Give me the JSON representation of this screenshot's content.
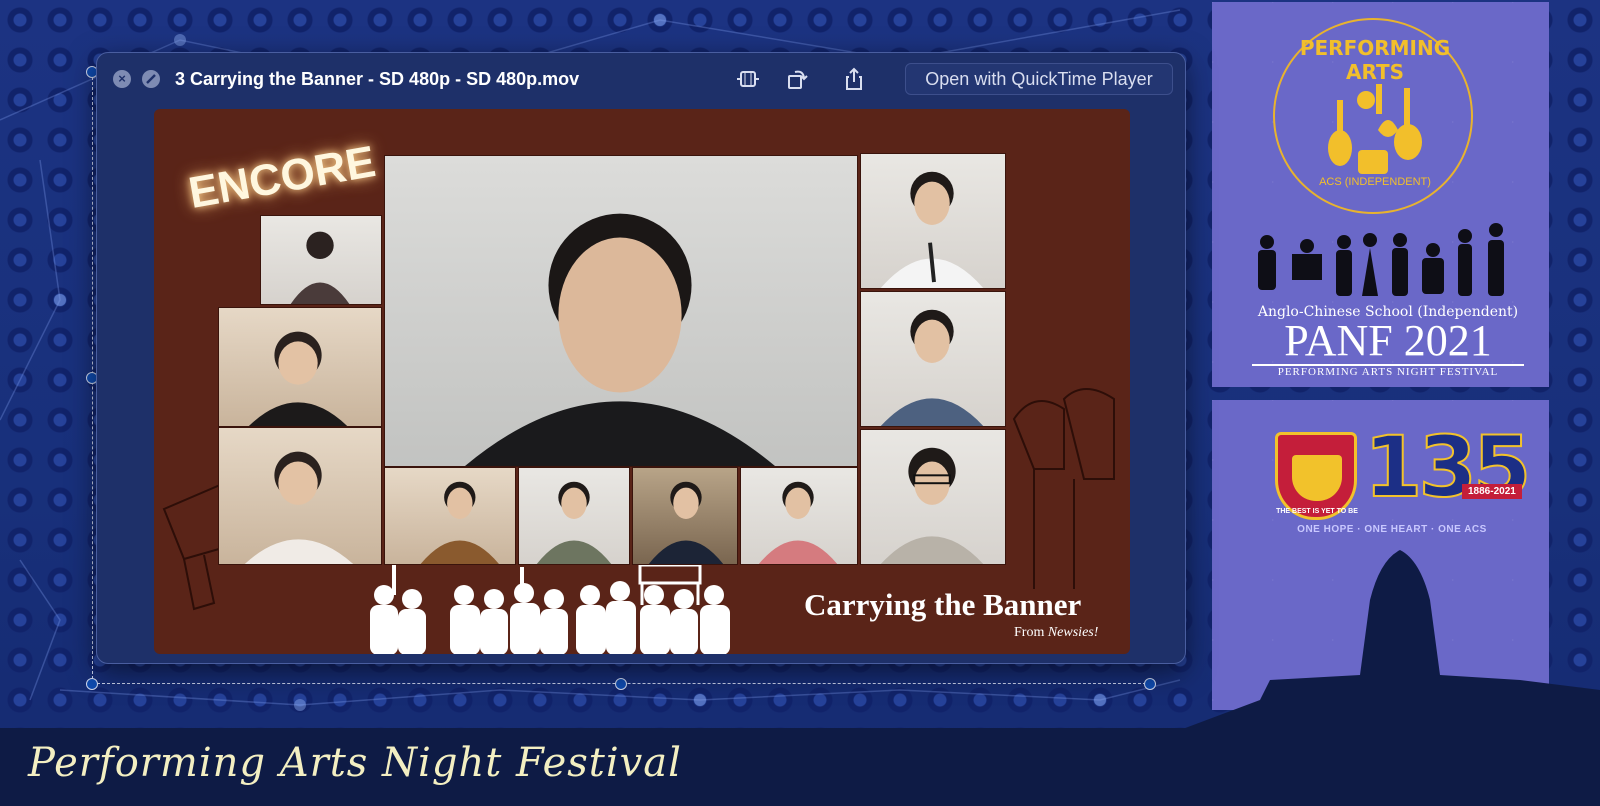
{
  "window": {
    "title": "3 Carrying the Banner - SD 480p - SD 480p.mov",
    "close_glyph": "×",
    "open_with_label": "Open with QuickTime Player",
    "icons": [
      "close-icon",
      "trim-icon",
      "trim-video-icon",
      "rotate-icon",
      "share-icon"
    ]
  },
  "video": {
    "encore_label": "ENCORE",
    "song_title": "Carrying the Banner",
    "song_from": "From ",
    "song_source": "Newsies!"
  },
  "background": {
    "pa_logo_text": "PERFORMING ARTS",
    "pa_logo_sub": "ACS (INDEPENDENT)",
    "school_name": "Anglo-Chinese School (Independent)",
    "panf_title": "PANF 2021",
    "panf_subtitle": "PERFORMING ARTS NIGHT FESTIVAL",
    "anniversary": "135",
    "years": "1886-2021",
    "motto": "ONE HOPE · ONE HEART · ONE ACS",
    "crest_banner": "THE BEST IS YET TO BE",
    "festival_title": "Performing Arts Night Festival"
  },
  "colors": {
    "desktop": "#1a2f78",
    "panel": "#6a68c8",
    "gold": "#f2bf2b",
    "window": "#1e3069",
    "video_bg": "#5a2418"
  }
}
